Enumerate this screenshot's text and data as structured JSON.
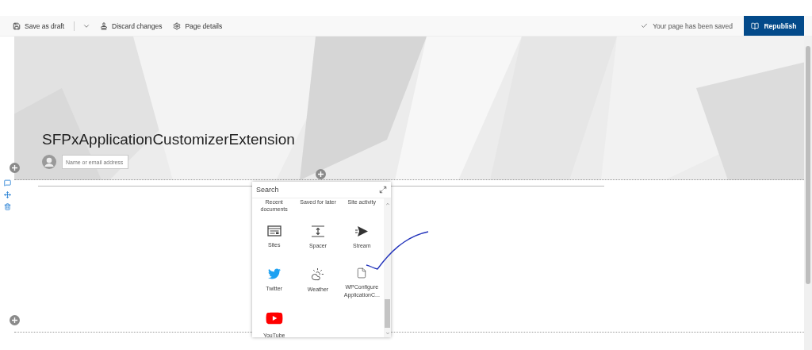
{
  "toolbar": {
    "actions": [
      {
        "kind": "save",
        "label": "Save as draft",
        "menu": true
      },
      {
        "kind": "discard",
        "label": "Discard changes",
        "menu": false
      },
      {
        "kind": "details",
        "label": "Page details",
        "menu": false
      }
    ],
    "status": "Your page has been saved",
    "primary": "Republish"
  },
  "banner": {
    "title": "SFPxApplicationCustomizerExtension",
    "author_field": {
      "placeholder": "Name or email address"
    }
  },
  "picker": {
    "search": {
      "placeholder": "Search"
    },
    "items": [
      {
        "kind": "cut",
        "label": "Recent documents"
      },
      {
        "kind": "cut",
        "label": "Saved for later"
      },
      {
        "kind": "cut",
        "label": "Site activity"
      },
      {
        "kind": "sites",
        "label": "Sites"
      },
      {
        "kind": "spacer",
        "label": "Spacer"
      },
      {
        "kind": "stream",
        "label": "Stream"
      },
      {
        "kind": "twitter",
        "label": "Twitter"
      },
      {
        "kind": "weather",
        "label": "Weather"
      },
      {
        "kind": "file",
        "label": "WPConfigure ApplicationC..."
      },
      {
        "kind": "youtube",
        "label": "YouTube"
      }
    ]
  }
}
